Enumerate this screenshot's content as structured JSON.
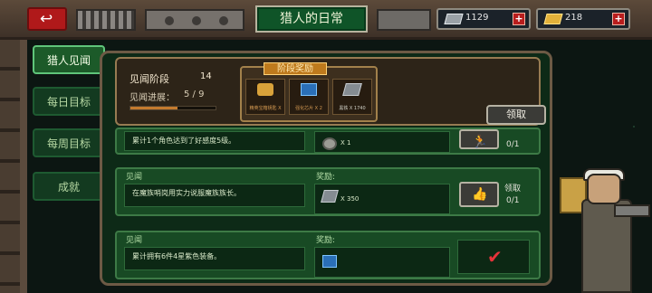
{
  "header": {
    "title": "猎人的日常",
    "resources": [
      {
        "name": "steel",
        "value": "1129",
        "icon": "steel-ingot-icon"
      },
      {
        "name": "gold",
        "value": "218",
        "icon": "gold-bar-icon"
      }
    ]
  },
  "tabs": [
    {
      "label": "猎人见闻",
      "active": true
    },
    {
      "label": "每日目标",
      "active": false
    },
    {
      "label": "每周目标",
      "active": false
    },
    {
      "label": "成就",
      "active": false
    }
  ],
  "stage": {
    "label": "见闻阶段",
    "number": "14",
    "progress_label": "见闻进展：",
    "progress_value": "5 / 9",
    "progress_fraction": 0.556
  },
  "stage_reward": {
    "title": "阶段奖励",
    "claim_label": "领取",
    "items": [
      {
        "icon": "key-icon",
        "name": "精英宝箱钥匙 X"
      },
      {
        "icon": "chip-icon",
        "name": "强化芯片 X 2"
      },
      {
        "icon": "steel-ingot-icon",
        "name": "黑铁 X 1740"
      }
    ]
  },
  "tasks": [
    {
      "tag": "",
      "desc": "累计1个角色达到了好感度5级。",
      "reward_label": "",
      "reward_icon": "gear-icon",
      "reward_count": "X 1",
      "action": "claim",
      "claim_label": "",
      "count": "0/1"
    },
    {
      "tag": "见闻",
      "desc": "在魔族哨岗用实力说服魔族族长。",
      "reward_label": "奖励:",
      "reward_icon": "steel-ingot-icon",
      "reward_count": "X 350",
      "action": "claim",
      "claim_label": "领取",
      "count": "0/1"
    },
    {
      "tag": "见闻",
      "desc": "累计拥有6件4星紫色装备。",
      "reward_label": "奖励:",
      "reward_icon": "chip-icon",
      "reward_count": "",
      "action": "done",
      "claim_label": "",
      "count": ""
    }
  ]
}
